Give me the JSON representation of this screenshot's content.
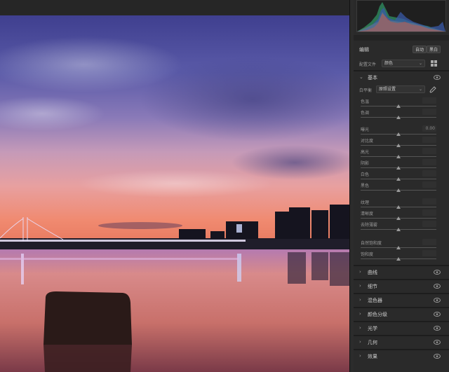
{
  "panel": {
    "edit_title": "编辑",
    "auto_label": "自动",
    "bw_label": "黑白",
    "profile": {
      "label": "配置文件",
      "value": "颜色"
    },
    "basic": {
      "title": "基本",
      "wb": {
        "label": "白平衡",
        "value": "原照设置"
      },
      "sliders": [
        {
          "label": "色温",
          "value": "",
          "level": 0.5
        },
        {
          "label": "色调",
          "value": "",
          "level": 0.5
        },
        {
          "label": "曝光",
          "value": "0.00",
          "level": 0.5
        },
        {
          "label": "对比度",
          "value": "",
          "level": 0.5
        },
        {
          "label": "高光",
          "value": "",
          "level": 0.5
        },
        {
          "label": "阴影",
          "value": "",
          "level": 0.5
        },
        {
          "label": "白色",
          "value": "",
          "level": 0.5
        },
        {
          "label": "黑色",
          "value": "",
          "level": 0.5
        },
        {
          "label": "纹理",
          "value": "",
          "level": 0.5
        },
        {
          "label": "清晰度",
          "value": "",
          "level": 0.5
        },
        {
          "label": "去除薄雾",
          "value": "",
          "level": 0.5
        },
        {
          "label": "自然饱和度",
          "value": "",
          "level": 0.5
        },
        {
          "label": "饱和度",
          "value": "",
          "level": 0.5
        }
      ]
    },
    "sections": [
      {
        "title": "曲线"
      },
      {
        "title": "细节"
      },
      {
        "title": "混色器"
      },
      {
        "title": "颜色分级"
      },
      {
        "title": "光学"
      },
      {
        "title": "几何"
      },
      {
        "title": "效果"
      }
    ]
  },
  "colors": {
    "panel_bg": "#2a2a2a",
    "canvas_bg": "#1a1a1a",
    "sky_top": "#4a4a95",
    "sunset": "#f08a70",
    "water": "#d07a70"
  },
  "icons": [
    "eye-icon",
    "chevron-right-icon",
    "chevron-down-icon",
    "eyedropper-icon",
    "grid-icon"
  ]
}
